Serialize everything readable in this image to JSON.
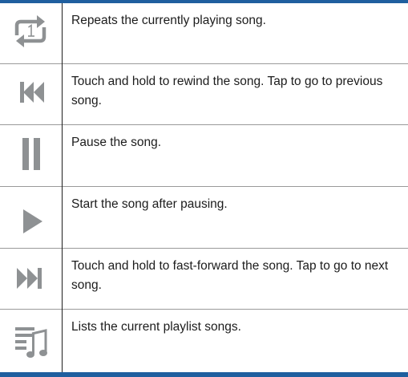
{
  "accent_color": "#1f5f9f",
  "icon_color": "#8e9193",
  "rows": [
    {
      "icon": "repeat-one-icon",
      "description": "Repeats the currently playing song."
    },
    {
      "icon": "rewind-previous-icon",
      "description": "Touch and hold to rewind the song. Tap to go to previous song."
    },
    {
      "icon": "pause-icon",
      "description": "Pause the song."
    },
    {
      "icon": "play-icon",
      "description": "Start the song after pausing."
    },
    {
      "icon": "fast-forward-next-icon",
      "description": "Touch and hold to fast-forward the song. Tap to go to next song."
    },
    {
      "icon": "playlist-icon",
      "description": "Lists the current playlist songs."
    }
  ]
}
